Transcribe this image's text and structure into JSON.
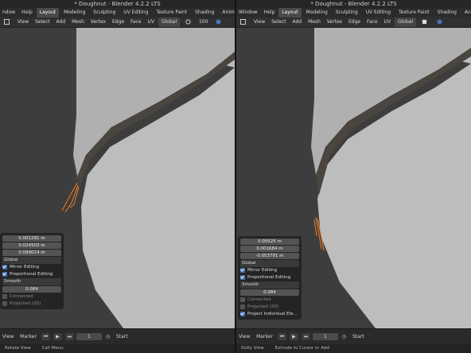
{
  "colors": {
    "accent": "#4772b3",
    "mesh": "#b9b9b9",
    "rim": "#4a453e",
    "edge_orange": "#e07a2a"
  },
  "left": {
    "title": "* Doughnut - Blender 4.2.2 LTS",
    "topbar": {
      "menu": [
        "ndow",
        "Help"
      ],
      "workspaces": [
        "Layout",
        "Modeling",
        "Sculpting",
        "UV Editing",
        "Texture Paint",
        "Shading",
        "Animation"
      ]
    },
    "header": {
      "menus": [
        "View",
        "Select",
        "Add",
        "Mesh",
        "Vertex",
        "Edge",
        "Face",
        "UV"
      ],
      "orientation": "Global",
      "prop_size": "100"
    },
    "operator": {
      "values": [
        "0.001291 m",
        "0.024503 m",
        "0.099014 m"
      ],
      "orientation": "Global",
      "mirror_editing": "Mirror Editing",
      "proportional_editing": "Proportional Editing",
      "falloff": "Smooth",
      "size": "0.084",
      "connected": "Connected",
      "projected": "Projected (2D)"
    },
    "timeline": {
      "view": "View",
      "marker": "Marker",
      "frame": "1",
      "start": "Start"
    },
    "status": {
      "left": "Rotate View",
      "middle": "Call Menu"
    }
  },
  "right": {
    "title": "* Doughnut - Blender 4.2.2 LTS",
    "topbar": {
      "menu": [
        "Window",
        "Help"
      ],
      "workspaces": [
        "Layout",
        "Modeling",
        "Sculpting",
        "UV Editing",
        "Texture Paint",
        "Shading",
        "Animation"
      ]
    },
    "header": {
      "menus": [
        "View",
        "Select",
        "Add",
        "Mesh",
        "Vertex",
        "Edge",
        "Face",
        "UV"
      ],
      "orientation": "Global"
    },
    "operator": {
      "values": [
        "0.00525 m",
        "0.001684 m",
        "-0.053791 m"
      ],
      "orientation": "Global",
      "mirror_editing": "Mirror Editing",
      "proportional_editing": "Proportional Editing",
      "falloff": "Smooth",
      "size": "0.084",
      "connected": "Connected",
      "projected": "Projected (2D)",
      "project_individual": "Project Individual Ele..."
    },
    "timeline": {
      "view": "View",
      "marker": "Marker",
      "frame": "1",
      "start": "Start"
    },
    "status": {
      "left": "Dolly View",
      "middle": "Extrude to Cursor or Add"
    }
  }
}
